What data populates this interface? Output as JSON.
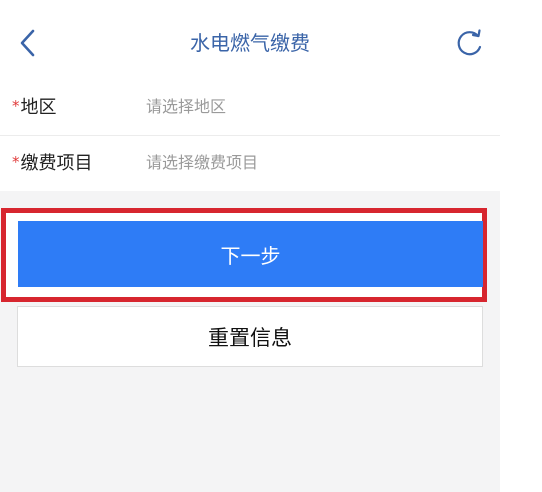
{
  "header": {
    "title": "水电燃气缴费",
    "back_icon": "chevron-left-icon",
    "refresh_icon": "refresh-icon",
    "accent_color": "#3a64a8"
  },
  "form": {
    "fields": [
      {
        "required_mark": "*",
        "label": "地区",
        "placeholder": "请选择地区",
        "value": ""
      },
      {
        "required_mark": "*",
        "label": "缴费项目",
        "placeholder": "请选择缴费项目",
        "value": ""
      }
    ]
  },
  "actions": {
    "next_label": "下一步",
    "reset_label": "重置信息",
    "primary_color": "#2e7cf6",
    "highlight_color": "#d7262f"
  }
}
